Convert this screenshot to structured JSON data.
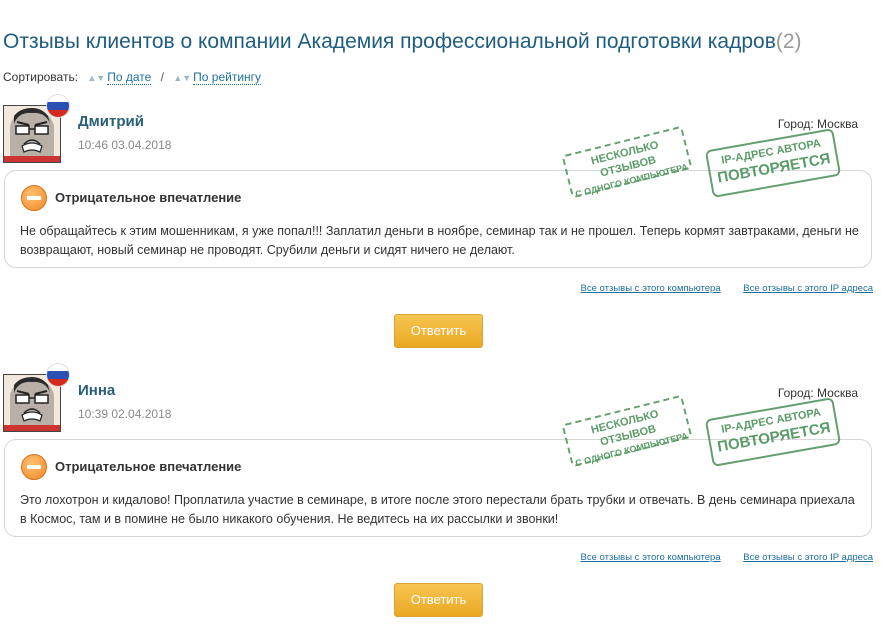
{
  "page": {
    "title": "Отзывы клиентов о компании Академия профессиональной подготовки кадров",
    "count": "(2)"
  },
  "sort": {
    "label": "Сортировать:",
    "by_date": "По дате",
    "separator": "/",
    "by_rating": "По рейтингу"
  },
  "stamps": {
    "multi_line1": "Несколько отзывов",
    "multi_line2": "с одного компьютера",
    "ip_line1": "IP-адрес автора",
    "ip_line2": "повторяется"
  },
  "reviews": [
    {
      "name": "Дмитрий",
      "date": "10:46 03.04.2018",
      "city": "Город: Москва",
      "impression": "Отрицательное впечатление",
      "text": "Не обращайтесь к этим мошенникам, я уже попал!!! Заплатил деньги в ноябре, семинар так и не прошел. Теперь кормят завтраками, деньги не возвращают, новый семинар не проводят. Срубили деньги и сидят ничего не делают.",
      "link_computer": "Все отзывы с этого компьютера",
      "link_ip": "Все отзывы с этого IP адреса",
      "reply": "Ответить"
    },
    {
      "name": "Инна",
      "date": "10:39 02.04.2018",
      "city": "Город: Москва",
      "impression": "Отрицательное впечатление",
      "text": "Это лохотрон и кидалово! Проплатила участие в семинаре, в итоге после этого перестали брать трубки и отвечать. В день семинара приехала в Космос, там и в помине не было никакого обучения. Не ведитесь на их рассылки и звонки!",
      "link_computer": "Все отзывы с этого компьютера",
      "link_ip": "Все отзывы с этого IP адреса",
      "reply": "Ответить"
    }
  ],
  "colors": {
    "title": "#1e5d80",
    "link": "#1e6fa0",
    "stamp": "#4b8f57",
    "reply_button": "#eaa821",
    "negative_icon": "#f08a2a"
  }
}
